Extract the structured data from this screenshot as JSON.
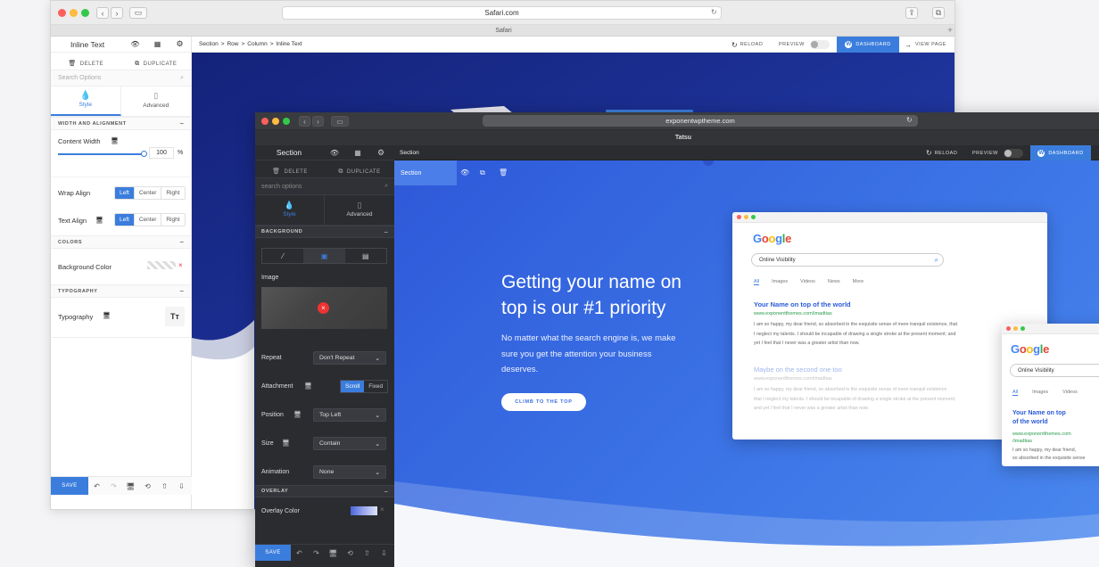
{
  "back_window": {
    "url": "Safari.com",
    "tab_title": "Safari",
    "panel": {
      "title": "Inline Text",
      "delete_label": "DELETE",
      "duplicate_label": "DUPLICATE",
      "search_placeholder": "Search Options",
      "tab_style": "Style",
      "tab_advanced": "Advanced",
      "sections": {
        "width_alignment": "WIDTH AND ALIGNMENT",
        "colors": "COLORS",
        "typography": "TYPOGRAPHY"
      },
      "content_width_label": "Content Width",
      "content_width_value": "100",
      "content_width_unit": "%",
      "content_width_fraction": 1.0,
      "wrap_align_label": "Wrap Align",
      "text_align_label": "Text Align",
      "align_options": [
        "Left",
        "Center",
        "Right"
      ],
      "wrap_align_selected": "Left",
      "text_align_selected": "Left",
      "background_color_label": "Background Color",
      "typography_label": "Typography",
      "typography_btn": "Tт",
      "save_label": "SAVE"
    },
    "breadcrumb": [
      "Section",
      "Row",
      "Column",
      "Inline Text"
    ],
    "breadcrumb_sep": ">",
    "reload_label": "RELOAD",
    "preview_label": "PREVIEW",
    "dashboard_label": "DASHBOARD",
    "view_page_label": "VIEW PAGE"
  },
  "front_window": {
    "url": "exponentwptheme.com",
    "tab_title": "Tatsu",
    "panel": {
      "title": "Section",
      "delete_label": "DELETE",
      "duplicate_label": "DUPLICATE",
      "search_placeholder": "search options",
      "tab_style": "Style",
      "tab_advanced": "Advanced",
      "background_section": "BACKGROUND",
      "image_label": "Image",
      "repeat_label": "Repeat",
      "repeat_value": "Don't Repeat",
      "attachment_label": "Attachment",
      "attachment_options": [
        "Scroll",
        "Fixed"
      ],
      "attachment_selected": "Scroll",
      "position_label": "Position",
      "position_value": "Top Left",
      "size_label": "Size",
      "size_value": "Contain",
      "animation_label": "Animation",
      "animation_value": "None",
      "overlay_section": "OVERLAY",
      "overlay_color_label": "Overlay Color",
      "save_label": "SAVE"
    },
    "breadcrumb": "Section",
    "reload_label": "RELOAD",
    "preview_label": "PREVIEW",
    "dashboard_label": "DASHBOARD",
    "section_chip": "Section",
    "hero": {
      "heading_line1": "Getting your name on",
      "heading_line2": "top is our #1 priority",
      "body_line1": "No matter what the search engine is, we make",
      "body_line2": "sure you get the attention your business",
      "body_line3": "deserves.",
      "cta_label": "CLIMB TO THE TOP"
    }
  },
  "google_card_main": {
    "logo": [
      "G",
      "o",
      "o",
      "g",
      "l",
      "e"
    ],
    "query": "Online Visibility",
    "tabs": [
      "All",
      "Images",
      "Videos",
      "News",
      "More"
    ],
    "result1_title": "Your Name on top of the world",
    "result1_url": "www.exponentthemes.com/imadtias",
    "result1_lines": [
      "I am so happy, my dear friend, so absorbed in the exquisite sense of mere tranquil existence, that",
      "I neglect my talents. I should be incapable of drawing a single stroke at the present moment; and",
      "yet I feel that I never was a greater artist than now."
    ],
    "result2_title": "Maybe on the second one too",
    "result2_url": "www.exponentthemes.com/imadtias",
    "result2_lines": [
      "I am so happy, my dear friend, so absorbed in the exquisite sense of mere tranquil existence",
      "that I neglect my talents. I should be incapable of drawing a single stroke at the present moment;",
      "and yet I feel that I never was a greater artist than now."
    ]
  },
  "google_card_small": {
    "query": "Online Visibility",
    "tabs": [
      "All",
      "Images",
      "Videos"
    ],
    "result_title_line1": "Your Name on top",
    "result_title_line2": "of the world",
    "result_url_line1": "www.exponentthemes.com",
    "result_url_line2": "/imadtias",
    "result_lines": [
      "I am so happy, my dear friend,",
      "so absorbed in the exquisite sense"
    ]
  },
  "colors": {
    "accent": "#3b7ddd",
    "google_blue": "#4285f4",
    "google_red": "#ea4335",
    "google_yellow": "#fbbc05",
    "google_green": "#34a853",
    "hero_back": "#1a2a8c"
  }
}
